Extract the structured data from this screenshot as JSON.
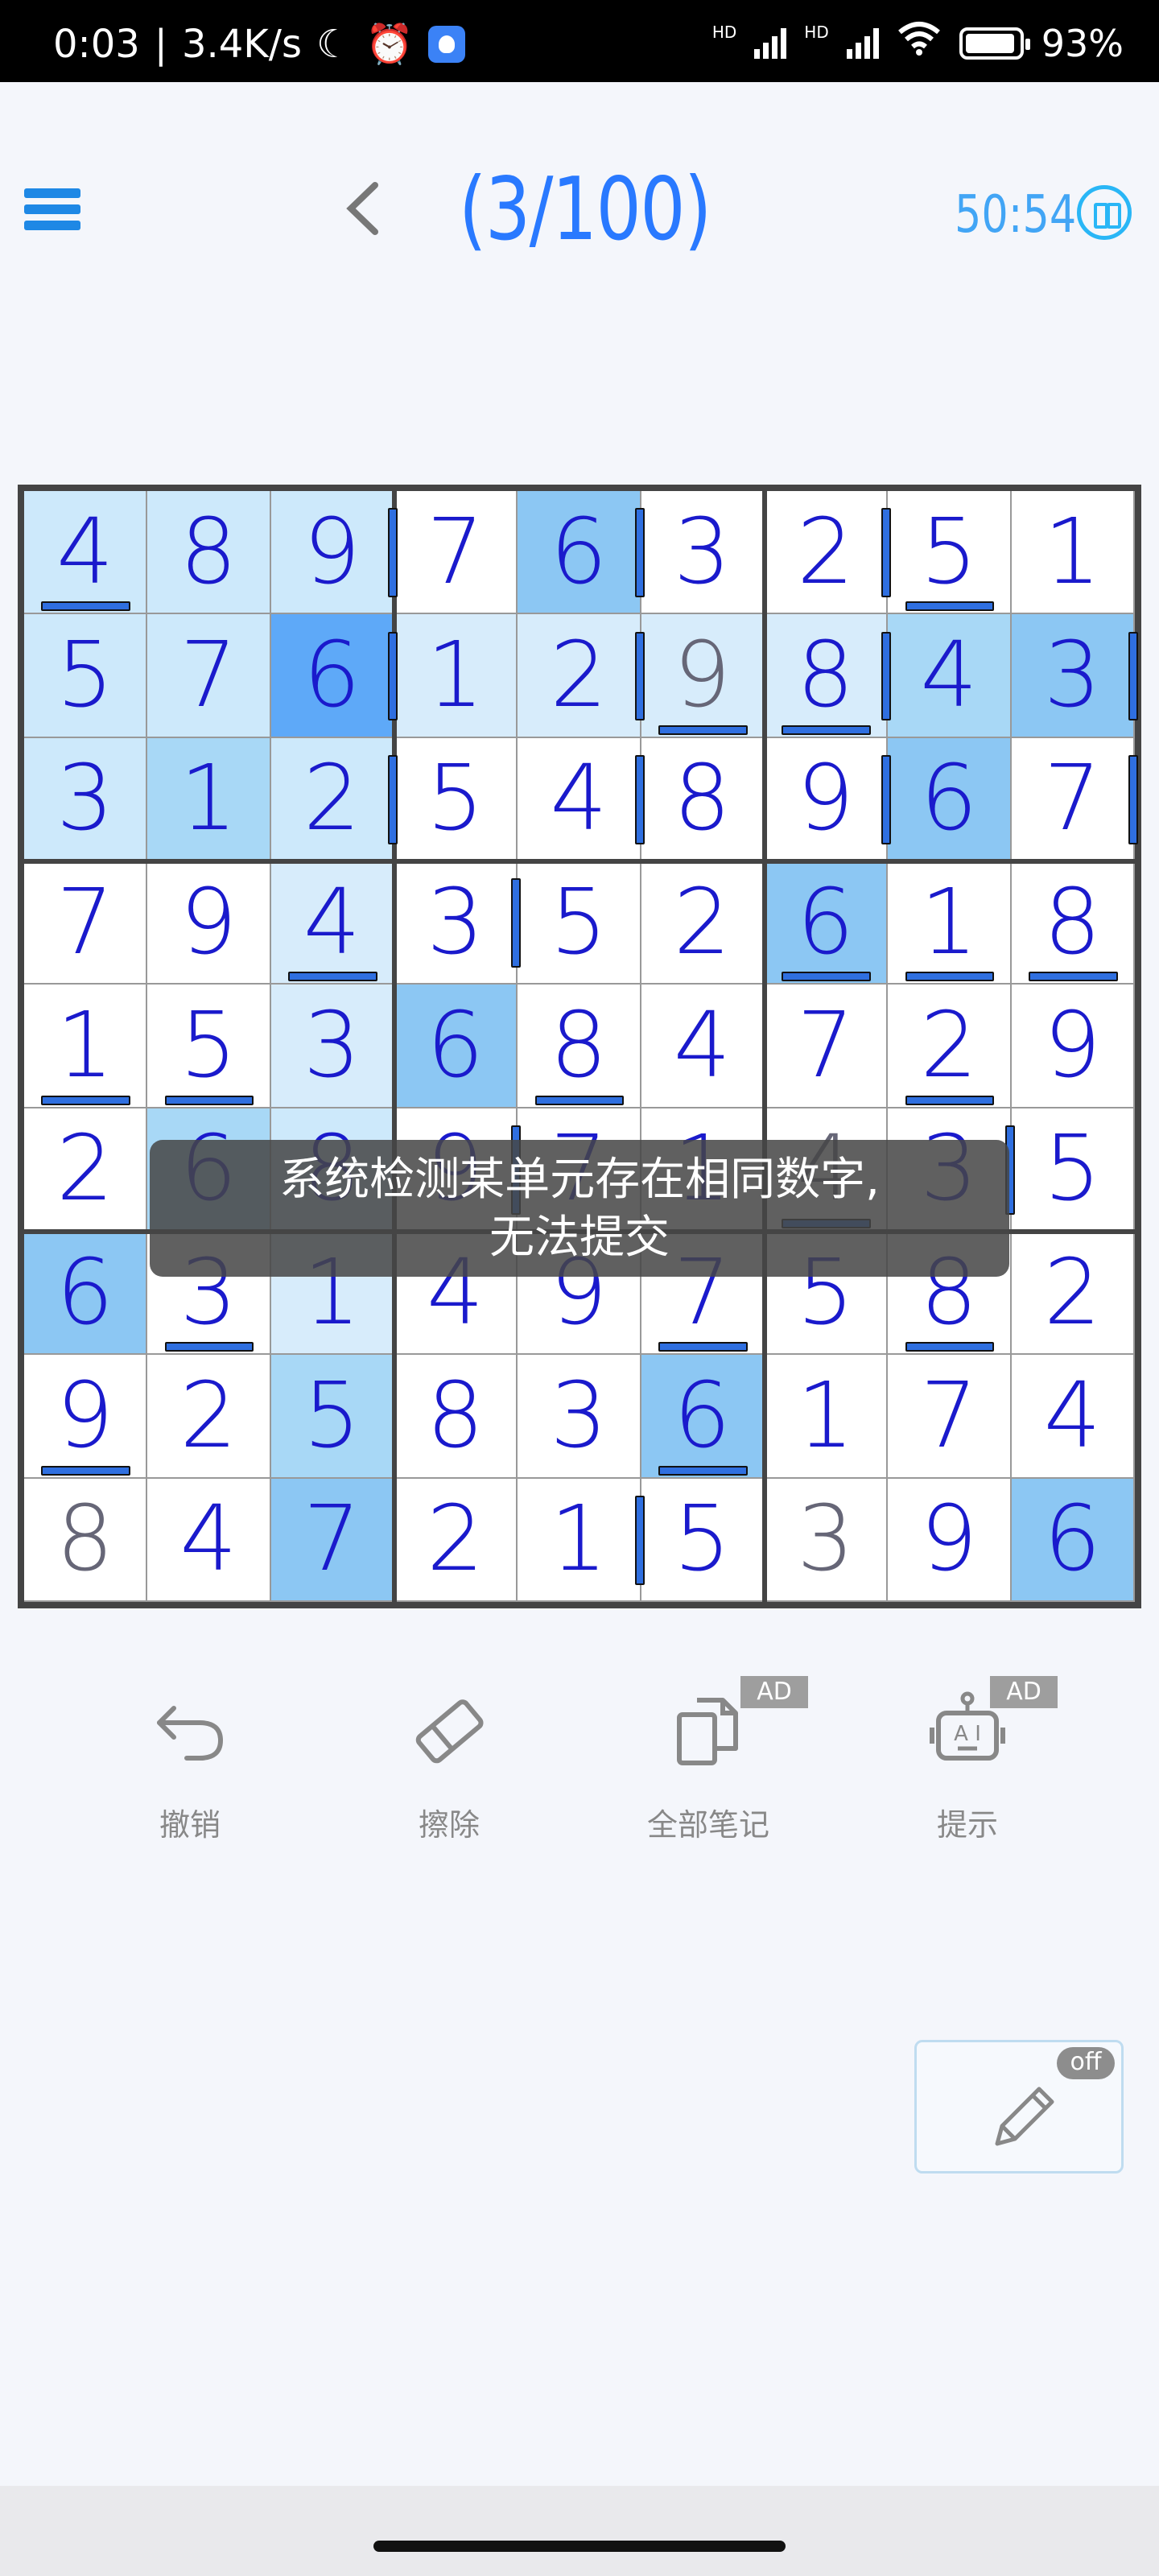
{
  "status_bar": {
    "time": "0:03",
    "speed": "3.4K/s",
    "battery": "93%",
    "hd1": "HD",
    "hd2": "HD"
  },
  "header": {
    "level": "(3/100)",
    "timer": "50:54"
  },
  "board": {
    "rows": [
      [
        "4",
        "8",
        "9",
        "7",
        "6",
        "3",
        "2",
        "5",
        "1"
      ],
      [
        "5",
        "7",
        "6",
        "1",
        "2",
        "9",
        "8",
        "4",
        "3"
      ],
      [
        "3",
        "1",
        "2",
        "5",
        "4",
        "8",
        "9",
        "6",
        "7"
      ],
      [
        "7",
        "9",
        "4",
        "3",
        "5",
        "2",
        "6",
        "1",
        "8"
      ],
      [
        "1",
        "5",
        "3",
        "6",
        "8",
        "4",
        "7",
        "2",
        "9"
      ],
      [
        "2",
        "6",
        "8",
        "9",
        "7",
        "1",
        "4",
        "3",
        "5"
      ],
      [
        "6",
        "3",
        "1",
        "4",
        "9",
        "7",
        "5",
        "8",
        "2"
      ],
      [
        "9",
        "2",
        "5",
        "8",
        "3",
        "6",
        "1",
        "7",
        "4"
      ],
      [
        "8",
        "4",
        "7",
        "2",
        "1",
        "5",
        "3",
        "9",
        "6"
      ]
    ],
    "given": [
      [
        1,
        5
      ],
      [
        5,
        6
      ],
      [
        8,
        0
      ],
      [
        8,
        6
      ]
    ],
    "highlights": [
      [
        0,
        0,
        1
      ],
      [
        0,
        1,
        1
      ],
      [
        0,
        2,
        1
      ],
      [
        0,
        4,
        3
      ],
      [
        1,
        0,
        1
      ],
      [
        1,
        1,
        1
      ],
      [
        1,
        2,
        4
      ],
      [
        1,
        3,
        5
      ],
      [
        1,
        4,
        5
      ],
      [
        1,
        5,
        5
      ],
      [
        1,
        6,
        5
      ],
      [
        1,
        7,
        2
      ],
      [
        1,
        8,
        3
      ],
      [
        2,
        0,
        1
      ],
      [
        2,
        1,
        2
      ],
      [
        2,
        2,
        1
      ],
      [
        2,
        7,
        3
      ],
      [
        3,
        2,
        5
      ],
      [
        3,
        6,
        3
      ],
      [
        4,
        2,
        5
      ],
      [
        4,
        3,
        3
      ],
      [
        5,
        1,
        2
      ],
      [
        5,
        2,
        1
      ],
      [
        6,
        0,
        3
      ],
      [
        6,
        2,
        5
      ],
      [
        7,
        2,
        2
      ],
      [
        7,
        5,
        3
      ],
      [
        8,
        2,
        3
      ],
      [
        8,
        8,
        3
      ]
    ],
    "marks_h": [
      [
        0,
        0
      ],
      [
        0,
        7
      ],
      [
        1,
        5
      ],
      [
        1,
        6
      ],
      [
        3,
        2
      ],
      [
        3,
        6
      ],
      [
        3,
        7
      ],
      [
        3,
        8
      ],
      [
        4,
        0
      ],
      [
        4,
        1
      ],
      [
        4,
        4
      ],
      [
        4,
        7
      ],
      [
        5,
        6
      ],
      [
        6,
        1
      ],
      [
        6,
        5
      ],
      [
        6,
        7
      ],
      [
        7,
        0
      ],
      [
        7,
        5
      ]
    ],
    "marks_v": [
      [
        0,
        2
      ],
      [
        0,
        4
      ],
      [
        0,
        6
      ],
      [
        1,
        2
      ],
      [
        1,
        4
      ],
      [
        1,
        6
      ],
      [
        1,
        8
      ],
      [
        2,
        2
      ],
      [
        2,
        4
      ],
      [
        2,
        6
      ],
      [
        2,
        8
      ],
      [
        3,
        3
      ],
      [
        5,
        3
      ],
      [
        5,
        7
      ],
      [
        8,
        4
      ]
    ]
  },
  "toast": {
    "line1": "系统检测某单元存在相同数字,",
    "line2": "无法提交"
  },
  "toolbar": {
    "undo_label": "撤销",
    "erase_label": "擦除",
    "notes_label": "全部笔记",
    "hint_label": "提示",
    "ad_label": "AD",
    "hint_icon_text": "A I"
  },
  "pencil": {
    "state": "off"
  },
  "colors": {
    "accent": "#2979ff",
    "digit": "#1a1acc",
    "given_digit": "#667788",
    "highlight_dark": "#5ea9f8"
  }
}
